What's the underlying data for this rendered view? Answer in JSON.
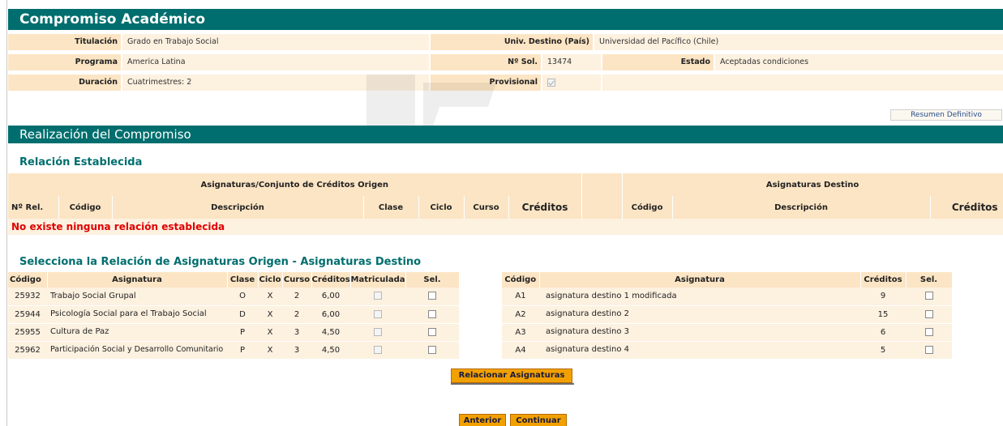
{
  "header": {
    "title": "Compromiso Académico"
  },
  "info": {
    "titulacion_label": "Titulación",
    "titulacion": "Grado en Trabajo Social",
    "programa_label": "Programa",
    "programa": "America Latina",
    "duracion_label": "Duración",
    "duracion": "Cuatrimestres: 2",
    "univ_label": "Univ. Destino (País)",
    "univ": "Universidad del Pacífico (Chile)",
    "nsol_label": "Nº Sol.",
    "nsol": "13474",
    "estado_label": "Estado",
    "estado": "Aceptadas condiciones",
    "provisional_label": "Provisional",
    "provisional_checked": true
  },
  "links": {
    "resumen": "Resumen Definitivo"
  },
  "section": {
    "title": "Realización del Compromiso"
  },
  "relacion": {
    "title": "Relación Establecida",
    "origen_group": "Asignaturas/Conjunto de Créditos Origen",
    "destino_group": "Asignaturas Destino",
    "columns": [
      "Nº Rel.",
      "Código",
      "Descripción",
      "Clase",
      "Ciclo",
      "Curso",
      "Créditos",
      "Código",
      "Descripción",
      "Créditos"
    ],
    "empty_message": "No existe ninguna relación establecida"
  },
  "seleccion": {
    "title": "Selecciona la Relación de Asignaturas Origen - Asignaturas Destino",
    "origen_columns": [
      "Código",
      "Asignatura",
      "Clase",
      "Ciclo",
      "Curso",
      "Créditos",
      "Matriculada",
      "Sel."
    ],
    "origen_rows": [
      {
        "codigo": "25932",
        "asignatura": "Trabajo Social Grupal",
        "clase": "O",
        "ciclo": "X",
        "curso": "2",
        "creditos": "6,00"
      },
      {
        "codigo": "25944",
        "asignatura": "Psicología Social para el Trabajo Social",
        "clase": "D",
        "ciclo": "X",
        "curso": "2",
        "creditos": "6,00"
      },
      {
        "codigo": "25955",
        "asignatura": "Cultura de Paz",
        "clase": "P",
        "ciclo": "X",
        "curso": "3",
        "creditos": "4,50"
      },
      {
        "codigo": "25962",
        "asignatura": "Participación Social y Desarrollo Comunitario",
        "clase": "P",
        "ciclo": "X",
        "curso": "3",
        "creditos": "4,50"
      }
    ],
    "destino_columns": [
      "Código",
      "Asignatura",
      "Créditos",
      "Sel."
    ],
    "destino_rows": [
      {
        "codigo": "A1",
        "asignatura": "asignatura destino 1 modificada",
        "creditos": "9"
      },
      {
        "codigo": "A2",
        "asignatura": "asignatura destino 2",
        "creditos": "15"
      },
      {
        "codigo": "A3",
        "asignatura": "asignatura destino 3",
        "creditos": "6"
      },
      {
        "codigo": "A4",
        "asignatura": "asignatura destino 4",
        "creditos": "5"
      }
    ]
  },
  "buttons": {
    "relacionar": "Relacionar Asignaturas",
    "anterior": "Anterior",
    "continuar": "Continuar"
  },
  "colors": {
    "teal": "#006e6e",
    "orange": "#f2a000",
    "label_bg": "#fce5c4",
    "value_bg": "#fdf1e0",
    "error": "#e00000"
  }
}
